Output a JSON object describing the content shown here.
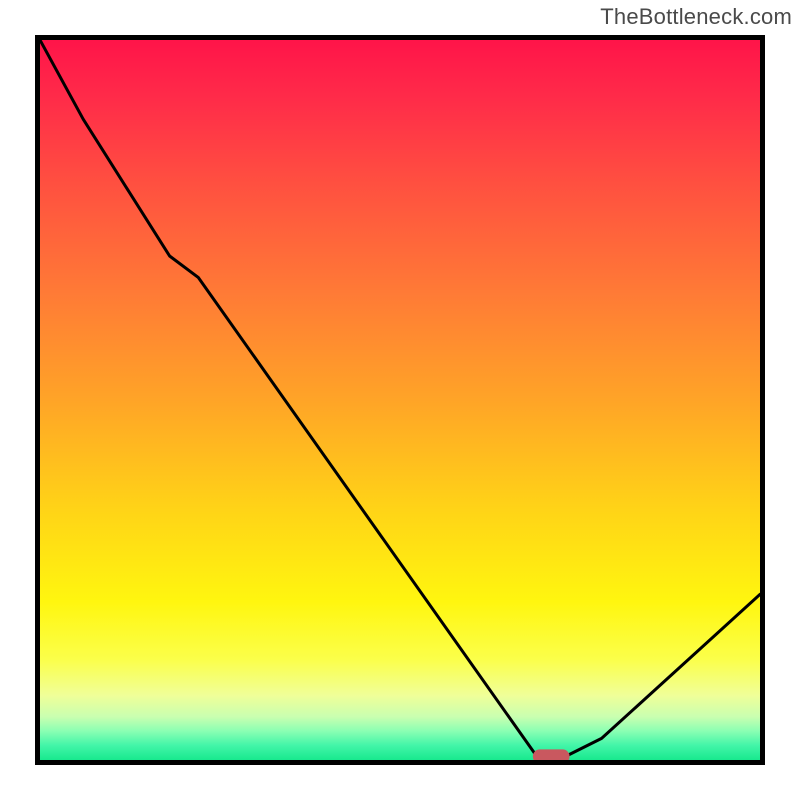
{
  "watermark": "TheBottleneck.com",
  "chart_data": {
    "type": "line",
    "x": [
      0,
      6,
      18,
      22,
      69,
      73,
      78,
      100
    ],
    "y": [
      100,
      89,
      70,
      67,
      0.5,
      0.5,
      3,
      23
    ],
    "xlim": [
      0,
      100
    ],
    "ylim": [
      0,
      100
    ],
    "title": "",
    "xlabel": "",
    "ylabel": "",
    "marker": {
      "x_range": [
        69,
        73
      ],
      "y": 0.5,
      "color": "#c9585f"
    },
    "background_gradient": {
      "stops": [
        {
          "pct": 0,
          "color": "#ff1449"
        },
        {
          "pct": 8,
          "color": "#ff2b49"
        },
        {
          "pct": 20,
          "color": "#ff5040"
        },
        {
          "pct": 35,
          "color": "#ff7a36"
        },
        {
          "pct": 50,
          "color": "#ffa427"
        },
        {
          "pct": 65,
          "color": "#ffd317"
        },
        {
          "pct": 78,
          "color": "#fff60f"
        },
        {
          "pct": 86,
          "color": "#fbff4a"
        },
        {
          "pct": 91,
          "color": "#f0ff98"
        },
        {
          "pct": 94,
          "color": "#c9ffb0"
        },
        {
          "pct": 96,
          "color": "#8affb3"
        },
        {
          "pct": 98,
          "color": "#42f5a8"
        },
        {
          "pct": 100,
          "color": "#18e98e"
        }
      ]
    }
  }
}
